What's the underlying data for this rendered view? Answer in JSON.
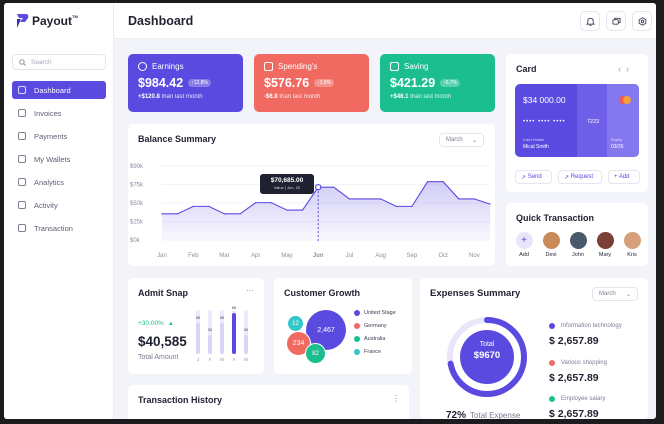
{
  "app": {
    "name": "Payout",
    "tm": "TM",
    "colors": {
      "primary": "#5b4ae0",
      "danger": "#f16a62",
      "success": "#1bbf8f",
      "teal": "#34c6c8"
    }
  },
  "header": {
    "title": "Dashboard",
    "icons": [
      "bell-icon",
      "messages-icon",
      "settings-icon"
    ]
  },
  "sidebar": {
    "search_placeholder": "Search",
    "items": [
      {
        "label": "Dashboard",
        "icon": "grid-icon",
        "active": true
      },
      {
        "label": "Invoices",
        "icon": "invoice-icon"
      },
      {
        "label": "Payments",
        "icon": "payment-icon"
      },
      {
        "label": "My Wallets",
        "icon": "wallet-icon"
      },
      {
        "label": "Analytics",
        "icon": "analytics-icon"
      },
      {
        "label": "Activity",
        "icon": "activity-icon"
      },
      {
        "label": "Transaction",
        "icon": "transaction-icon"
      }
    ]
  },
  "stats": {
    "earnings": {
      "label": "Earnings",
      "value": "$984.42",
      "badge": "↑12.8%",
      "delta": "+$120.8",
      "delta_text": "than last month",
      "color": "#5b4ae0"
    },
    "spending": {
      "label": "Spending's",
      "value": "$576.76",
      "badge": "↓3.8%",
      "delta": "-$6.8",
      "delta_text": "than last month",
      "color": "#f16a62"
    },
    "saving": {
      "label": "Saving",
      "value": "$421.29",
      "badge": "↑6.7%",
      "delta": "+$46.1",
      "delta_text": "than last month",
      "color": "#1bbf8f"
    }
  },
  "balance": {
    "title": "Balance Summary",
    "period": "March",
    "tooltip_value": "$70,685.00",
    "tooltip_label": "Value | Jun, 20"
  },
  "chart_data": {
    "type": "line",
    "title": "Balance Summary",
    "categories": [
      "Jan",
      "Feb",
      "Mar",
      "Apr",
      "May",
      "Jun",
      "Jul",
      "Aug",
      "Sep",
      "Oct",
      "Nov"
    ],
    "x_labels": [
      "Jan",
      "",
      "Feb",
      "",
      "Mar",
      "",
      "Apr",
      "",
      "May",
      "",
      "Jun",
      "",
      "Jul",
      "",
      "Aug",
      "",
      "Sep",
      "",
      "Oct",
      "",
      "Nov",
      ""
    ],
    "values": [
      35000,
      35000,
      45000,
      45000,
      35000,
      35000,
      50000,
      50000,
      40000,
      40000,
      70685,
      70685,
      55000,
      55000,
      55000,
      45000,
      45000,
      78000,
      78000,
      55000,
      55000,
      48000
    ],
    "yticks": [
      "$0k",
      "$25k",
      "$50k",
      "$75k",
      "$99k"
    ],
    "ylim": [
      0,
      99000
    ],
    "highlight": "Jun",
    "grid": true
  },
  "card": {
    "title": "Card",
    "balance": "$34 000.00",
    "number_masked": "•••• •••• ••••",
    "last4": "7223",
    "holder_label": "Card Holder",
    "holder": "Mical Smith",
    "expiry_label": "Expiry",
    "expiry": "03/26",
    "actions": [
      "Send",
      "Request",
      "+ Add"
    ]
  },
  "quick": {
    "title": "Quick Transaction",
    "people": [
      {
        "name": "Add",
        "color": "#e9e6fc"
      },
      {
        "name": "Devi",
        "color": "#c98a5a"
      },
      {
        "name": "John",
        "color": "#4b5a6b"
      },
      {
        "name": "Mary",
        "color": "#7a3f35"
      },
      {
        "name": "Kris",
        "color": "#d5a07a"
      }
    ]
  },
  "admit": {
    "title": "Admit Snap",
    "more": "···",
    "growth": "+30.00%",
    "value": "$40,585",
    "caption": "Total Amount",
    "bars": [
      {
        "label": "J",
        "value": 50
      },
      {
        "label": "F",
        "value": 30
      },
      {
        "label": "M",
        "value": 50
      },
      {
        "label": "A",
        "value": 65
      },
      {
        "label": "M",
        "value": 30
      }
    ]
  },
  "growth": {
    "title": "Customer Growth",
    "bubbles": [
      {
        "label": "2,467",
        "color": "#5b4ae0"
      },
      {
        "label": "234",
        "color": "#f16a62"
      },
      {
        "label": "82",
        "color": "#1bbf8f"
      },
      {
        "label": "12",
        "color": "#34c6c8"
      }
    ],
    "legend": [
      {
        "label": "United Stage",
        "color": "#5b4ae0"
      },
      {
        "label": "Germany",
        "color": "#f16a62"
      },
      {
        "label": "Australia",
        "color": "#1bbf8f"
      },
      {
        "label": "France",
        "color": "#34c6c8"
      }
    ]
  },
  "expenses": {
    "title": "Expenses Summary",
    "period": "March",
    "center_label": "Total",
    "center_value": "$9670",
    "percent": "72%",
    "percent_caption": "Total Expense",
    "percent_value": 72,
    "items": [
      {
        "label": "Information technology",
        "amount": "$ 2,657.89",
        "color": "#5b4ae0"
      },
      {
        "label": "Various shopping",
        "amount": "$ 2,657.89",
        "color": "#f16a62"
      },
      {
        "label": "Employee salary",
        "amount": "$ 2,657.89",
        "color": "#1bbf8f"
      }
    ]
  },
  "history": {
    "title": "Transaction History",
    "more": "⋮"
  }
}
